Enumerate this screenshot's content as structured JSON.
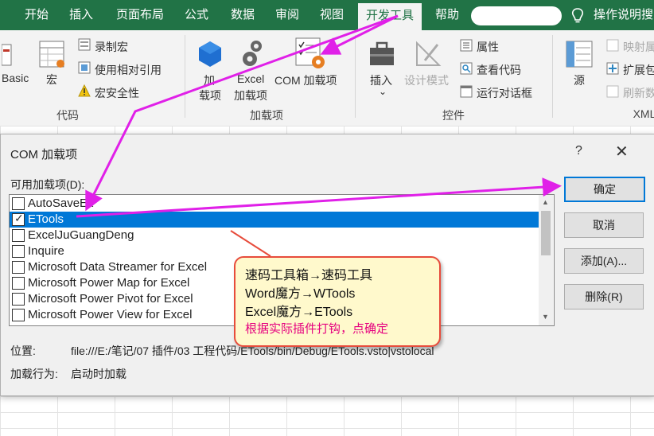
{
  "ribbon_tabs": [
    "开始",
    "插入",
    "页面布局",
    "公式",
    "数据",
    "审阅",
    "视图",
    "开发工具",
    "帮助"
  ],
  "active_tab": "开发工具",
  "help_text": "操作说明搜",
  "ribbon": {
    "code_group": {
      "label": "代码",
      "basic_label": "Basic",
      "macro_label": "宏",
      "record_macro": "录制宏",
      "relative_ref": "使用相对引用",
      "macro_security": "宏安全性"
    },
    "addins_group": {
      "label": "加载项",
      "addins_line1": "加",
      "addins_line2": "载项",
      "excel_addins_line1": "Excel",
      "excel_addins_line2": "加载项",
      "com_addins": "COM 加载项"
    },
    "controls_group": {
      "label": "控件",
      "insert": "插入",
      "design_mode": "设计模式",
      "properties": "属性",
      "view_code": "查看代码",
      "run_dialog": "运行对话框"
    },
    "xml_group": {
      "label": "XML",
      "source": "源",
      "map_props": "映射属",
      "expansion": "扩展包",
      "refresh": "刷新数"
    }
  },
  "dialog": {
    "title": "COM 加载项",
    "help_button": "?",
    "close_button": "✕",
    "available_label": "可用加载项(D):",
    "addins": [
      {
        "name": "AutoSaveEx",
        "checked": false,
        "selected": false
      },
      {
        "name": "ETools",
        "checked": true,
        "selected": true
      },
      {
        "name": "ExcelJuGuangDeng",
        "checked": false,
        "selected": false
      },
      {
        "name": "Inquire",
        "checked": false,
        "selected": false
      },
      {
        "name": "Microsoft Data Streamer for Excel",
        "checked": false,
        "selected": false
      },
      {
        "name": "Microsoft Power Map for Excel",
        "checked": false,
        "selected": false
      },
      {
        "name": "Microsoft Power Pivot for Excel",
        "checked": false,
        "selected": false
      },
      {
        "name": "Microsoft Power View for Excel",
        "checked": false,
        "selected": false
      }
    ],
    "buttons": {
      "ok": "确定",
      "cancel": "取消",
      "add": "添加(A)...",
      "remove": "删除(R)"
    },
    "location_label": "位置:",
    "location_value": "file:///E:/笔记/07 插件/03 工程代码/ETools/bin/Debug/ETools.vsto|vstolocal",
    "load_behavior_label": "加载行为:",
    "load_behavior_value": "启动时加载"
  },
  "callout": {
    "line1": "速码工具箱→速码工具",
    "line2": "Word魔方→WTools",
    "line3": "Excel魔方→ETools",
    "line4": "根据实际插件打钩，点确定"
  },
  "colors": {
    "excel_green": "#217346",
    "annotation_arrow": "#e020e8",
    "selection_blue": "#0078d7",
    "callout_border": "#e74c3c",
    "callout_fill": "#fff9cc"
  }
}
